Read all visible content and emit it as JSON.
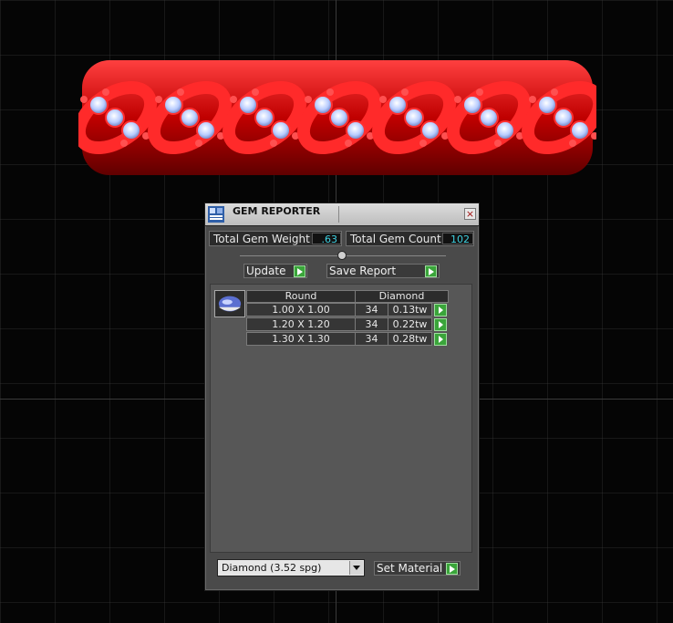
{
  "window": {
    "title": "GEM REPORTER",
    "close_glyph": "×",
    "icons": {
      "app": "gem-reporter-icon",
      "close": "close-icon"
    }
  },
  "totals": {
    "weight_label": "Total Gem Weight",
    "weight_value": ".63",
    "count_label": "Total Gem Count",
    "count_value": "102"
  },
  "actions": {
    "update_label": "Update",
    "save_report_label": "Save Report"
  },
  "table": {
    "shape_header": "Round",
    "material_header": "Diamond",
    "rows": [
      {
        "size": "1.00 X 1.00",
        "count": "34",
        "weight": "0.13tw"
      },
      {
        "size": "1.20 X 1.20",
        "count": "34",
        "weight": "0.22tw"
      },
      {
        "size": "1.30 X 1.30",
        "count": "34",
        "weight": "0.28tw"
      }
    ]
  },
  "material": {
    "selected": "Diamond     (3.52 spg)",
    "set_label": "Set Material"
  },
  "colors": {
    "model_red": "#d00000",
    "gem_blue": "#c8d8ff",
    "value_cyan": "#3fd0e0",
    "button_green": "#3aa53a"
  }
}
